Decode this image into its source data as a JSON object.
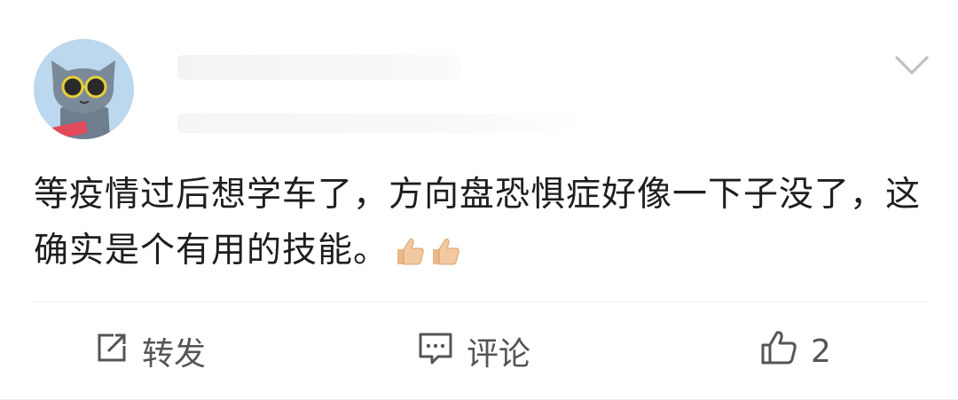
{
  "post": {
    "text": "等疫情过后想学车了，方向盘恐惧症好像一下子没了，这确实是个有用的技能。",
    "emojis": [
      "thumbs-up-emoji",
      "thumbs-up-emoji"
    ]
  },
  "actions": {
    "repost_label": "转发",
    "comment_label": "评论",
    "like_count": "2"
  },
  "icons": {
    "repost": "repost-icon",
    "comment": "comment-icon",
    "like": "thumbs-up-icon",
    "menu": "chevron-down-icon"
  },
  "colors": {
    "text": "#1e1e1e",
    "action_text": "#555555",
    "avatar_bg": "#bcd8ee"
  }
}
